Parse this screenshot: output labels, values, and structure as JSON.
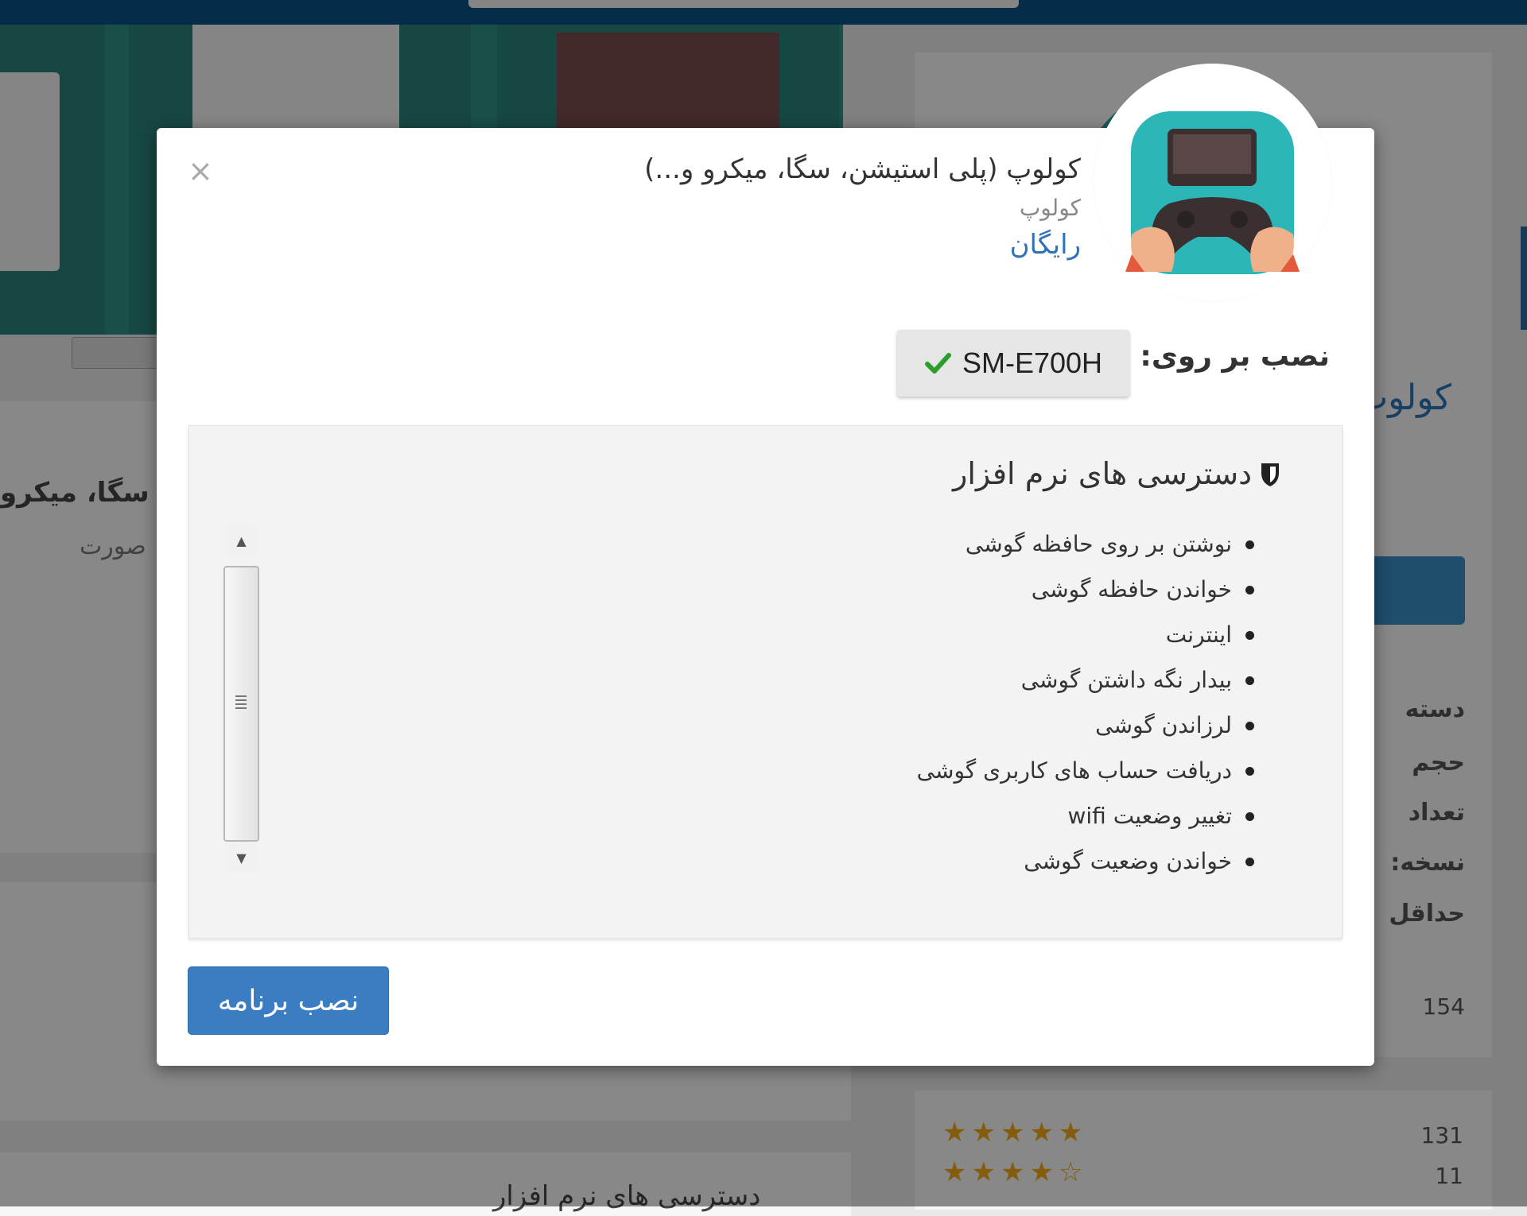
{
  "background": {
    "left_app_name": "ی، سگا، میکرو",
    "left_developer": "صورت",
    "left_permissions_heading": "دسترسی های نرم افزار",
    "right_app_title": "کولوپ",
    "right_labels": [
      "دسته",
      "حجم",
      "تعداد",
      "نسخه:",
      "حداقل"
    ],
    "right_users_count": "154",
    "ratings": [
      {
        "stars": "★★★★★",
        "count": "131"
      },
      {
        "stars": "★★★★☆",
        "count": "11"
      }
    ]
  },
  "modal": {
    "close_label": "×",
    "app": {
      "name": "کولوپ (پلی استیشن، سگا، میکرو و...)",
      "developer": "کولوپ",
      "price": "رایگان",
      "icon": "gamepad-app-icon"
    },
    "install_on_label": "نصب بر روی:",
    "device": "SM-E700H",
    "permissions": {
      "title": "دسترسی های نرم افزار",
      "items": [
        "نوشتن بر روی حافظه گوشی",
        "خواندن حافظه گوشی",
        "اینترنت",
        "بیدار نگه داشتن گوشی",
        "لرزاندن گوشی",
        "دریافت حساب های کاربری گوشی",
        "تغییر وضعیت wifi",
        "خواندن وضعیت گوشی"
      ]
    },
    "install_button": "نصب برنامه"
  },
  "colors": {
    "accent": "#3b7dc2",
    "price": "#2f73b6",
    "check": "#2a9d2a",
    "topbar": "#0a5184"
  }
}
